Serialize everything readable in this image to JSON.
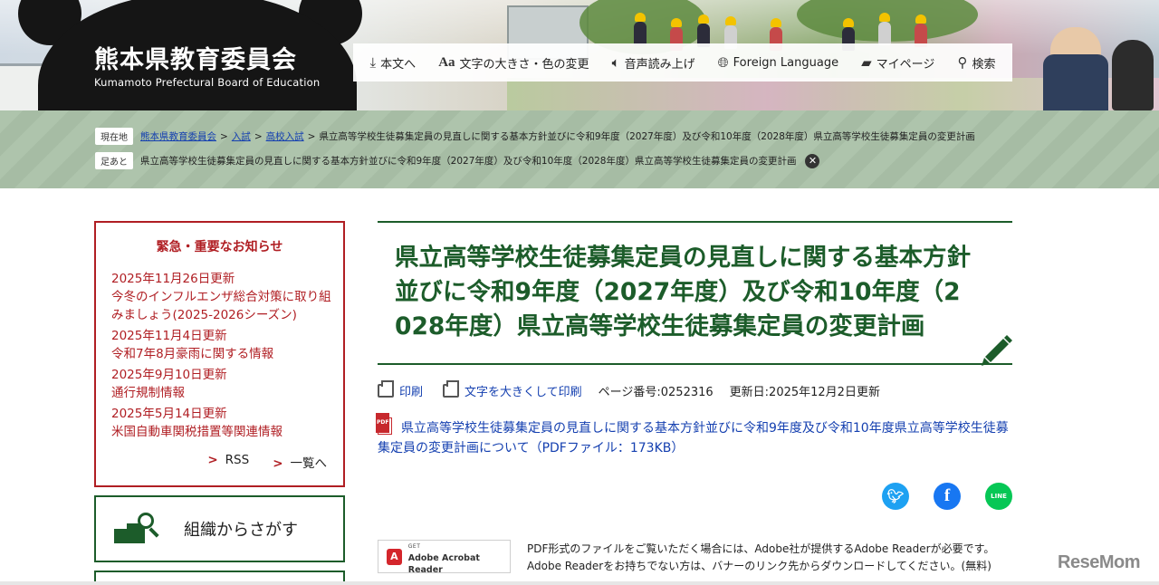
{
  "header": {
    "site_title": "熊本県教育委員会",
    "site_subtitle": "Kumamoto Prefectural Board of Education",
    "util_nav": [
      {
        "label": "本文へ",
        "icon": "download-icon"
      },
      {
        "label": "文字の大きさ・色の変更",
        "icon": "font-size-icon"
      },
      {
        "label": "音声読み上げ",
        "icon": "speaker-icon"
      },
      {
        "label": "Foreign Language",
        "icon": "globe-icon"
      },
      {
        "label": "マイページ",
        "icon": "folder-icon"
      },
      {
        "label": "検索",
        "icon": "search-icon"
      }
    ]
  },
  "breadcrumb": {
    "current_label": "現在地",
    "links": [
      "熊本県教育委員会",
      "入試",
      "高校入試"
    ],
    "separator": ">",
    "current": "県立高等学校生徒募集定員の見直しに関する基本方針並びに令和9年度（2027年度）及び令和10年度（2028年度）県立高等学校生徒募集定員の変更計画",
    "history_label": "足あと",
    "history_item": "県立高等学校生徒募集定員の見直しに関する基本方針並びに令和9年度（2027年度）及び令和10年度（2028年度）県立高等学校生徒募集定員の変更計画"
  },
  "notices": {
    "title": "緊急・重要なお知らせ",
    "items": [
      {
        "date": "2025年11月26日更新",
        "text": "今冬のインフルエンザ総合対策に取り組みましょう(2025-2026シーズン)"
      },
      {
        "date": "2025年11月4日更新",
        "text": "令和7年8月豪雨に関する情報"
      },
      {
        "date": "2025年9月10日更新",
        "text": "通行規制情報"
      },
      {
        "date": "2025年5月14日更新",
        "text": "米国自動車関税措置等関連情報"
      }
    ],
    "rss_label": "RSS",
    "list_label": "一覧へ"
  },
  "sidebar": {
    "org_search_label": "組織からさがす"
  },
  "main": {
    "title": "県立高等学校生徒募集定員の見直しに関する基本方針並びに令和9年度（2027年度）及び令和10年度（2028年度）県立高等学校生徒募集定員の変更計画",
    "print_label": "印刷",
    "print_large_label": "文字を大きくして印刷",
    "page_number": "ページ番号:0252316",
    "updated": "更新日:2025年12月2日更新",
    "pdf_link": "県立高等学校生徒募集定員の見直しに関する基本方針並びに令和9年度及び令和10年度県立高等学校生徒募集定員の変更計画について（PDFファイル：173KB）",
    "social": {
      "line_label": "LINE"
    },
    "acrobat": {
      "get": "GET",
      "name": "Adobe Acrobat Reader"
    },
    "adobe_note": "PDF形式のファイルをご覧いただく場合には、Adobe社が提供するAdobe Readerが必要です。Adobe Readerをお持ちでない方は、バナーのリンク先からダウンロードしてください。(無料)"
  },
  "watermark": "ReseMom",
  "colors": {
    "brand_green": "#1c5c2a",
    "alert_red": "#b01e23",
    "link_blue": "#1540b0",
    "crumb_band": "#a9c0a7"
  }
}
